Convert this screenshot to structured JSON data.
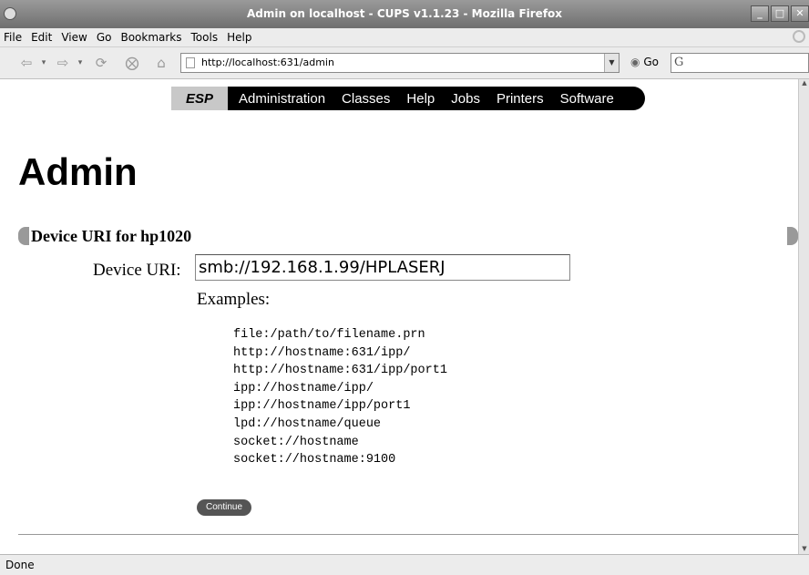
{
  "window": {
    "title": "Admin on localhost - CUPS v1.1.23 - Mozilla Firefox",
    "controls": [
      "_",
      "□",
      "✕"
    ]
  },
  "menubar": {
    "items": [
      "File",
      "Edit",
      "View",
      "Go",
      "Bookmarks",
      "Tools",
      "Help"
    ]
  },
  "toolbar": {
    "url": "http://localhost:631/admin",
    "go_label": "Go",
    "search_value": ""
  },
  "esp_nav": {
    "logo": "ESP",
    "links": [
      "Administration",
      "Classes",
      "Help",
      "Jobs",
      "Printers",
      "Software"
    ]
  },
  "page": {
    "title": "Admin",
    "section_title": "Device URI for hp1020",
    "device_uri_label": "Device URI:",
    "device_uri_value": "smb://192.168.1.99/HPLASERJ",
    "examples_label": "Examples:",
    "examples": [
      "file:/path/to/filename.prn",
      "http://hostname:631/ipp/",
      "http://hostname:631/ipp/port1",
      "ipp://hostname/ipp/",
      "ipp://hostname/ipp/port1",
      "lpd://hostname/queue",
      "socket://hostname",
      "socket://hostname:9100"
    ],
    "continue_label": "Continue"
  },
  "status": {
    "text": "Done"
  },
  "colors": {
    "nav_bar": "#000000",
    "esp_logo_bg": "#c8c8c8",
    "section_cap": "#999999",
    "button_bg": "#555555"
  }
}
